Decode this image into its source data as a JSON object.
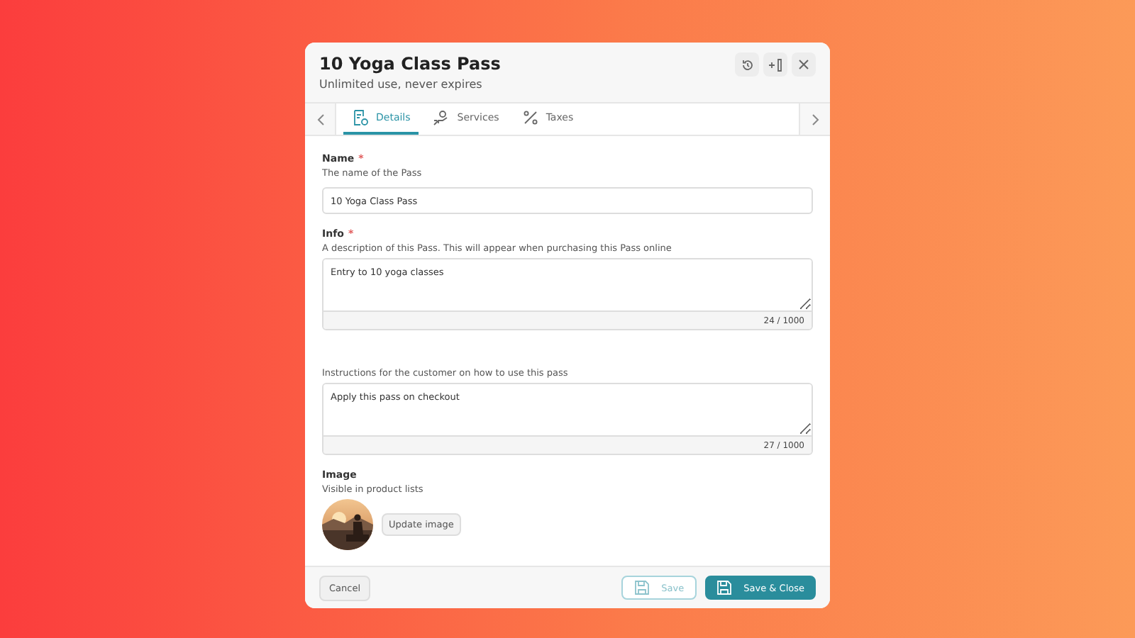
{
  "dialog": {
    "title": "10 Yoga Class Pass",
    "subtitle": "Unlimited use, never expires"
  },
  "tabs": [
    {
      "label": "Details",
      "selected": true
    },
    {
      "label": "Services",
      "selected": false
    },
    {
      "label": "Taxes",
      "selected": false
    }
  ],
  "fields": [
    {
      "kind": "text",
      "label": "Name",
      "required_mark": "*",
      "hint": "The name of the Pass",
      "value": "10 Yoga Class Pass"
    },
    {
      "kind": "textarea",
      "label": "Info",
      "required_mark": "*",
      "hint": "A description of this Pass. This will appear when purchasing this Pass online",
      "value": "Entry to 10 yoga classes",
      "counter": "24 / 1000"
    },
    {
      "kind": "textarea",
      "hint": "Instructions for the customer on how to use this pass",
      "value": "Apply this pass on checkout",
      "counter": "27 / 1000"
    }
  ],
  "image": {
    "label": "Image",
    "hint": "Visible in product lists",
    "button": "Update image"
  },
  "footer": {
    "cancel": "Cancel",
    "save": {
      "label": "Save",
      "disabled": true
    },
    "save_close": {
      "label": "Save & Close",
      "disabled": false
    }
  }
}
